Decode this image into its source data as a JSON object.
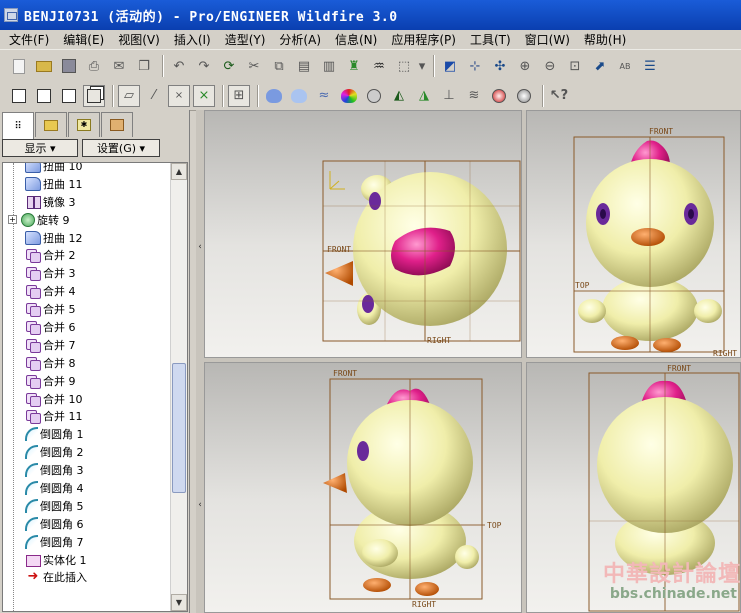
{
  "window": {
    "title": "BENJI0731 (活动的) - Pro/ENGINEER Wildfire 3.0"
  },
  "menu": [
    {
      "label": "文件(F)"
    },
    {
      "label": "编辑(E)"
    },
    {
      "label": "视图(V)"
    },
    {
      "label": "插入(I)"
    },
    {
      "label": "造型(Y)"
    },
    {
      "label": "分析(A)"
    },
    {
      "label": "信息(N)"
    },
    {
      "label": "应用程序(P)"
    },
    {
      "label": "工具(T)"
    },
    {
      "label": "窗口(W)"
    },
    {
      "label": "帮助(H)"
    }
  ],
  "toolbar1": {
    "icons": [
      "new-file-icon",
      "open-folder-icon",
      "save-icon",
      "print-icon",
      "email-icon",
      "copy-window-icon",
      "undo-icon",
      "redo-icon",
      "regenerate-icon",
      "cut-icon",
      "copy-icon",
      "paste-icon",
      "paste-special-icon",
      "model-player-icon",
      "find-icon",
      "selection-box-icon",
      "repaint-icon",
      "refit-icon",
      "spin-center-icon",
      "zoom-in-icon",
      "zoom-out-icon",
      "zoom-fit-icon",
      "reorient-icon",
      "saved-views-icon",
      "layers-icon"
    ]
  },
  "toolbar2": {
    "icons": [
      "wireframe-icon",
      "hidden-line-icon",
      "no-hidden-icon",
      "shading-icon",
      "datum-plane-icon",
      "datum-axis-icon",
      "datum-point-icon",
      "coordinate-system-icon",
      "sketch-icon",
      "style-feature-icon",
      "boundary-blend-icon",
      "swept-blend-icon",
      "color-icon",
      "appearance-icon",
      "annotation-icon",
      "sketch-view-icon",
      "measure-icon",
      "curve-analysis-icon",
      "surface-analysis-icon",
      "model-analysis-icon",
      "context-help-icon"
    ]
  },
  "panel": {
    "tabs": [
      "model-tree-tab",
      "folder-browser-tab",
      "favorites-tab",
      "connections-tab"
    ],
    "show_button": "显示 ▾",
    "settings_button": "设置(G) ▾"
  },
  "tree": [
    {
      "label": "扭曲 10",
      "icon": "sweep"
    },
    {
      "label": "扭曲 11",
      "icon": "sweep"
    },
    {
      "label": "镜像 3",
      "icon": "mirror"
    },
    {
      "label": "旋转 9",
      "icon": "revolve",
      "expandable": true
    },
    {
      "label": "扭曲 12",
      "icon": "sweep"
    },
    {
      "label": "合并 2",
      "icon": "merge"
    },
    {
      "label": "合并 3",
      "icon": "merge"
    },
    {
      "label": "合并 4",
      "icon": "merge"
    },
    {
      "label": "合并 5",
      "icon": "merge"
    },
    {
      "label": "合并 6",
      "icon": "merge"
    },
    {
      "label": "合并 7",
      "icon": "merge"
    },
    {
      "label": "合并 8",
      "icon": "merge"
    },
    {
      "label": "合并 9",
      "icon": "merge"
    },
    {
      "label": "合并 10",
      "icon": "merge"
    },
    {
      "label": "合并 11",
      "icon": "merge"
    },
    {
      "label": "倒圆角 1",
      "icon": "round"
    },
    {
      "label": "倒圆角 2",
      "icon": "round"
    },
    {
      "label": "倒圆角 3",
      "icon": "round"
    },
    {
      "label": "倒圆角 4",
      "icon": "round"
    },
    {
      "label": "倒圆角 5",
      "icon": "round"
    },
    {
      "label": "倒圆角 6",
      "icon": "round"
    },
    {
      "label": "倒圆角 7",
      "icon": "round"
    },
    {
      "label": "实体化 1",
      "icon": "solidify"
    },
    {
      "label": "在此插入",
      "icon": "insert"
    }
  ],
  "datums": {
    "front": "FRONT",
    "top": "TOP",
    "right": "RIGHT"
  },
  "colors": {
    "body": "#f0eeaa",
    "comb": "#e0208a",
    "beak": "#e06a10",
    "eye": "#6a2a9a",
    "datum": "#8a5a2a"
  },
  "watermark": {
    "text": "中華設計論壇",
    "url": "bbs.chinade.net"
  }
}
